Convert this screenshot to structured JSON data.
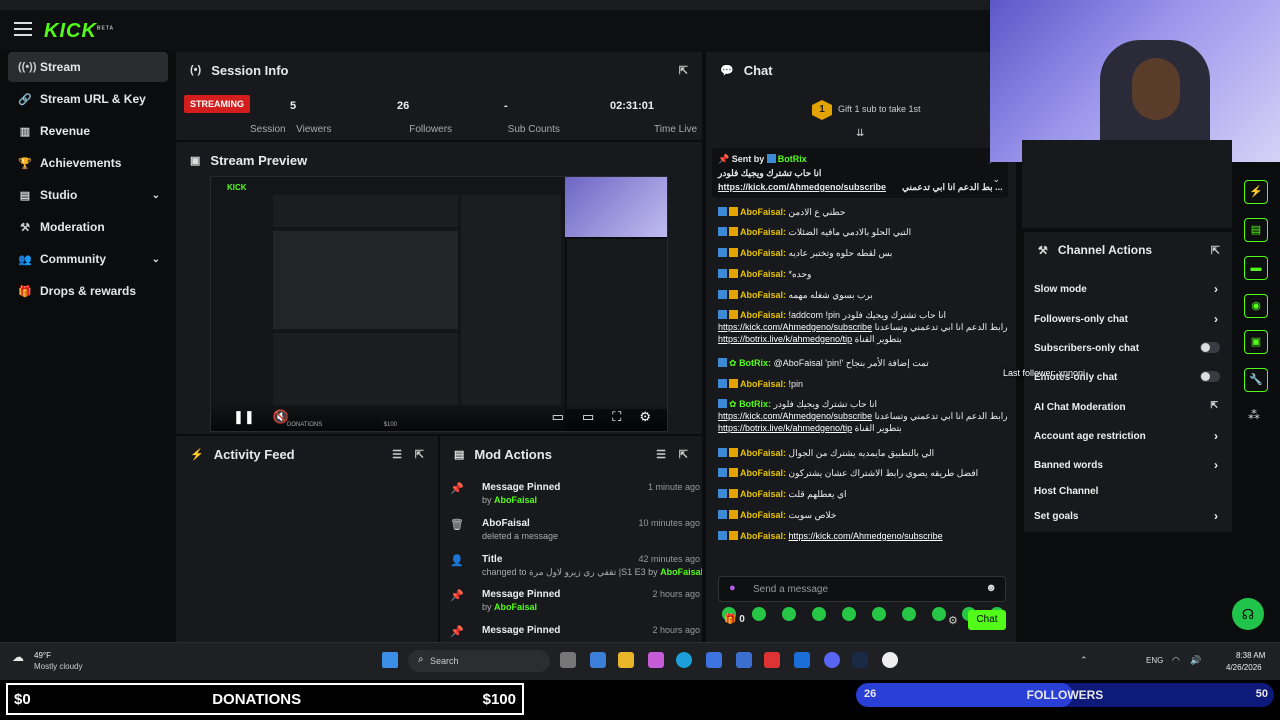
{
  "app": {
    "logo": "KICK",
    "logo_tag": "BETA"
  },
  "sidebar": {
    "items": [
      {
        "label": "Stream",
        "icon": "stream-icon",
        "active": true
      },
      {
        "label": "Stream URL & Key",
        "icon": "link-icon"
      },
      {
        "label": "Revenue",
        "icon": "chart-icon"
      },
      {
        "label": "Achievements",
        "icon": "trophy-icon"
      },
      {
        "label": "Studio",
        "icon": "studio-icon",
        "expandable": true
      },
      {
        "label": "Moderation",
        "icon": "hammer-icon"
      },
      {
        "label": "Community",
        "icon": "community-icon",
        "expandable": true
      },
      {
        "label": "Drops & rewards",
        "icon": "gift-icon"
      }
    ]
  },
  "session": {
    "title": "Session Info",
    "status": "STREAMING",
    "status_label": "Session",
    "stats": [
      {
        "value": "5",
        "label": "Viewers"
      },
      {
        "value": "26",
        "label": "Followers"
      },
      {
        "value": "-",
        "label": "Sub Counts"
      },
      {
        "value": "02:31:01",
        "label": "Time Live"
      }
    ]
  },
  "preview": {
    "title": "Stream Preview",
    "overlay_donations": "DONATIONS",
    "overlay_amount": "$100"
  },
  "activity": {
    "title": "Activity Feed"
  },
  "mod": {
    "title": "Mod Actions",
    "items": [
      {
        "title": "Message Pinned",
        "sub": "by ",
        "user": "AboFaisal",
        "time": "1 minute ago",
        "icon": "pin-icon"
      },
      {
        "title": "AboFaisal",
        "sub": "deleted a message",
        "user": "",
        "time": "10 minutes ago",
        "icon": "trash-icon"
      },
      {
        "title": "Title",
        "sub": "changed to تقفي ري زيرو لاول مرة |S1 E3 by ",
        "user": "AboFaisal",
        "time": "42 minutes ago",
        "icon": "title-icon"
      },
      {
        "title": "Message Pinned",
        "sub": "by ",
        "user": "AboFaisal",
        "time": "2 hours ago",
        "icon": "pin-icon"
      },
      {
        "title": "Message Pinned",
        "sub": "",
        "user": "",
        "time": "2 hours ago",
        "icon": "pin-icon"
      }
    ]
  },
  "chat": {
    "title": "Chat",
    "gift_text": "Gift 1 sub to take 1st",
    "gift_rank": "1",
    "pinned": {
      "sent_by": "Sent by",
      "user": "BotRix",
      "text": "انا حاب تشترك ويجيك فلودر",
      "link": "https://kick.com/Ahmedgeno/subscribe",
      "tail": "بط الدعم انا ابي تدعمني ..."
    },
    "messages": [
      {
        "user": "AboFaisal:",
        "text": "حطني ع الادمن"
      },
      {
        "user": "AboFaisal:",
        "text": "التبي الحلو بالادمي مافيه الضئلات"
      },
      {
        "user": "AboFaisal:",
        "text": "بس لقطه حلوه وتختبر عاديه"
      },
      {
        "user": "AboFaisal:",
        "text": "*وحده"
      },
      {
        "user": "AboFaisal:",
        "text": "برب بسوي شغله مهمه"
      },
      {
        "user": "AboFaisal:",
        "text": "!addcom !pin انا حاب تشترك ويجيك فلودر",
        "line2": "رابط الدعم انا ابي تدعمني وتساعدنا",
        "link": "https://kick.com/Ahmedgeno/subscribe",
        "line3": "بتطوير القناة",
        "link2": "https://botrix.live/k/ahmedgeno/tip"
      },
      {
        "user": "BotRix:",
        "bot": true,
        "text": "@AboFaisal 'pin!' تمت إضافة الأمر بنجاح"
      },
      {
        "user": "AboFaisal:",
        "text": "!pin"
      },
      {
        "user": "BotRix:",
        "bot": true,
        "text": "انا حاب تشترك ويجيك فلودر",
        "line2": "رابط الدعم انا ابي تدعمني وتساعدنا",
        "link": "https://kick.com/Ahmedgeno/subscribe",
        "line3": "بتطوير القناة",
        "link2": "https://botrix.live/k/ahmedgeno/tip"
      },
      {
        "user": "AboFaisal:",
        "text": "الي بالتطبيق مايمديه يشترك من الجوال"
      },
      {
        "user": "AboFaisal:",
        "text": "افضل طريقه يصوي رابط الاشتراك عشان يشتركون"
      },
      {
        "user": "AboFaisal:",
        "text": "اي يعطلهم قلت"
      },
      {
        "user": "AboFaisal:",
        "text": "خلاص سويت"
      },
      {
        "user": "AboFaisal:",
        "text": "",
        "link": "https://kick.com/Ahmedgeno/subscribe"
      }
    ],
    "input_placeholder": "Send a message",
    "points": "0",
    "send_label": "Chat"
  },
  "channel_actions": {
    "title": "Channel Actions",
    "items": [
      {
        "label": "Slow mode",
        "control": "chevron"
      },
      {
        "label": "Followers-only chat",
        "control": "chevron"
      },
      {
        "label": "Subscribers-only chat",
        "control": "toggle"
      },
      {
        "label": "Emotes-only chat",
        "control": "toggle"
      },
      {
        "label": "AI Chat Moderation",
        "control": "external"
      },
      {
        "label": "Account age restriction",
        "control": "chevron"
      },
      {
        "label": "Banned words",
        "control": "chevron"
      },
      {
        "label": "Host Channel",
        "control": "none"
      },
      {
        "label": "Set goals",
        "control": "chevron"
      }
    ]
  },
  "overlay": {
    "last_follower": "Last follower: xnnoni"
  },
  "taskbar": {
    "temp": "49°F",
    "weather": "Mostly cloudy",
    "search": "Search",
    "lang": "ENG",
    "time": "8:38 AM",
    "date": "4/26/2026"
  },
  "goals": {
    "donations_label": "DONATIONS",
    "donations_current": "$0",
    "donations_target": "$100",
    "followers_label": "FOLLOWERS",
    "followers_current": "26",
    "followers_target": "50",
    "followers_progress": 0.52
  },
  "colors": {
    "accent": "#53fc18",
    "streaming": "#d41d1d",
    "username": "#e8c400"
  }
}
